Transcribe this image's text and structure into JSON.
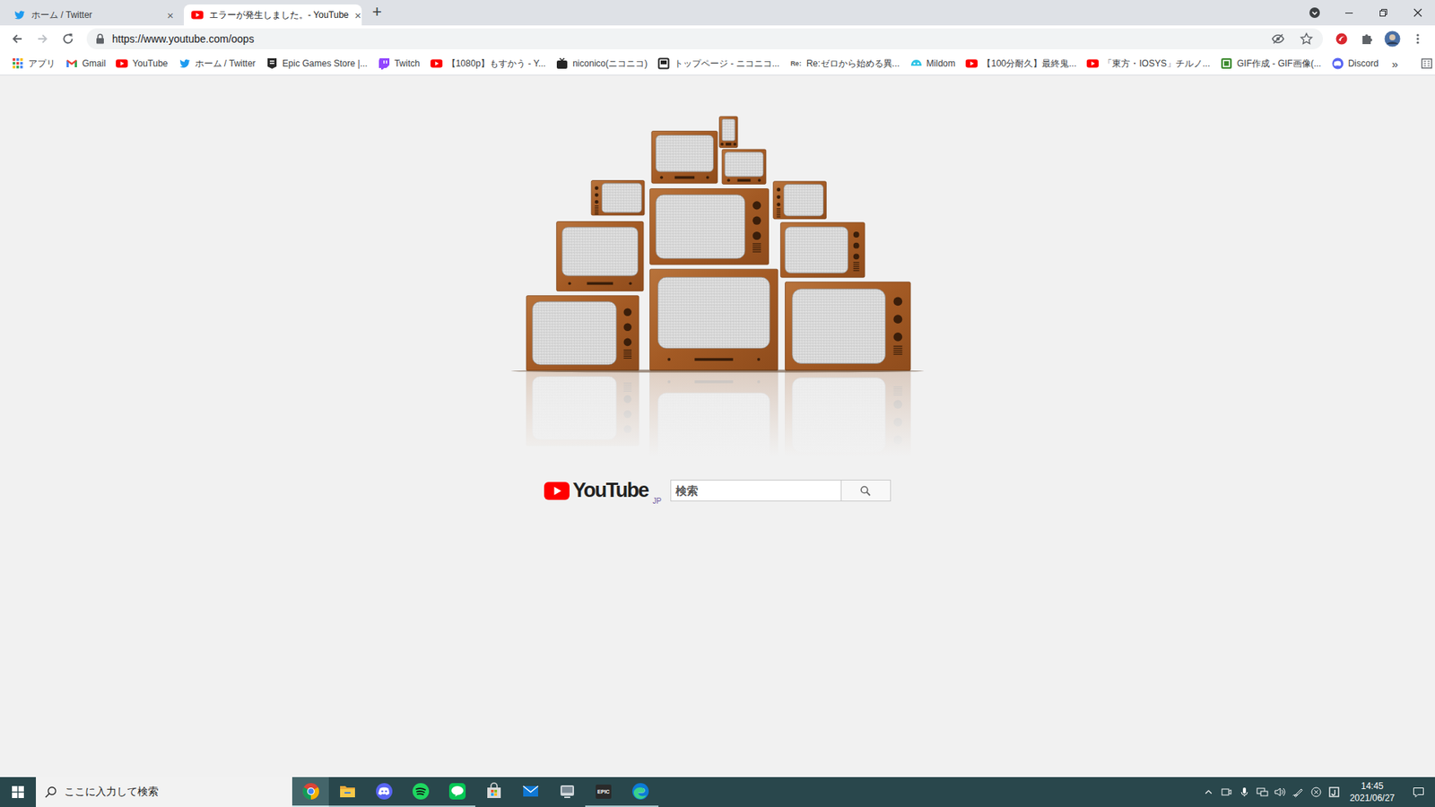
{
  "window": {
    "tabs": [
      {
        "label": "ホーム / Twitter",
        "kind": "twitter",
        "selected": false,
        "close": "×"
      },
      {
        "label": "エラーが発生しました。- YouTube",
        "kind": "youtube",
        "selected": true,
        "close": "×"
      }
    ],
    "new_tab": "+"
  },
  "toolbar": {
    "url": "https://www.youtube.com/oops",
    "forward_enabled": false
  },
  "bookmarks": {
    "items": [
      {
        "label": "アプリ",
        "kind": "apps"
      },
      {
        "label": "Gmail",
        "kind": "gmail"
      },
      {
        "label": "YouTube",
        "kind": "youtube"
      },
      {
        "label": "ホーム / Twitter",
        "kind": "twitter"
      },
      {
        "label": "Epic Games Store |...",
        "kind": "epic"
      },
      {
        "label": "Twitch",
        "kind": "twitch"
      },
      {
        "label": "【1080p】もすかう - Y...",
        "kind": "youtube"
      },
      {
        "label": "niconico(ニコニコ)",
        "kind": "niconico"
      },
      {
        "label": "トップページ - ニコニコ...",
        "kind": "page"
      },
      {
        "label": "Re:ゼロから始める異...",
        "kind": "re",
        "favicon_text": "Re:"
      },
      {
        "label": "Mildom",
        "kind": "mildom"
      },
      {
        "label": "【100分耐久】最終鬼...",
        "kind": "youtube"
      },
      {
        "label": "「東方・IOSYS」チルノ...",
        "kind": "youtube"
      },
      {
        "label": "GIF作成 - GIF画像(...",
        "kind": "gif"
      },
      {
        "label": "Discord",
        "kind": "discord"
      }
    ],
    "overflow": "»",
    "reading_list": "リーディング リスト"
  },
  "page": {
    "logo": "YouTube",
    "region": "JP",
    "search": {
      "placeholder": "検索"
    }
  },
  "taskbar": {
    "search_placeholder": "ここに入力して検索",
    "apps": [
      {
        "kind": "chrome",
        "running": true,
        "selected": true
      },
      {
        "kind": "explorer",
        "running": true,
        "selected": false
      },
      {
        "kind": "discord",
        "running": true,
        "selected": false
      },
      {
        "kind": "spotify",
        "running": true,
        "selected": false
      },
      {
        "kind": "line",
        "running": true,
        "selected": false
      },
      {
        "kind": "store",
        "running": false,
        "selected": false
      },
      {
        "kind": "mail",
        "running": false,
        "selected": false
      },
      {
        "kind": "app",
        "running": false,
        "selected": false
      },
      {
        "kind": "epic",
        "running": true,
        "selected": false,
        "icon_text": "EPIC"
      },
      {
        "kind": "edge",
        "running": true,
        "selected": false
      }
    ],
    "time": "14:45",
    "date": "2021/06/27"
  }
}
